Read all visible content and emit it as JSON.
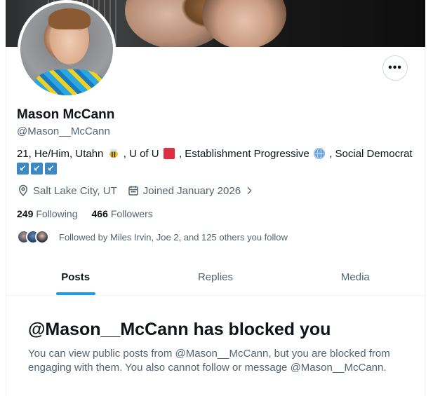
{
  "profile": {
    "name": "Mason McCann",
    "handle": "@Mason__McCann",
    "bio_part1": "21, He/Him, Utahn",
    "bio_part2": ", U of U",
    "bio_part3": ", Establishment Progressive",
    "bio_part4": ", Social Democrat",
    "location": "Salt Lake City, UT",
    "joined": "Joined January 2026",
    "following_count": "249",
    "following_label": "Following",
    "followers_count": "466",
    "followers_label": "Followers",
    "followed_by": "Followed by Miles Irvin, Joe 2, and 125 others you follow"
  },
  "more_button": "•••",
  "tabs": [
    {
      "label": "Posts",
      "active": true
    },
    {
      "label": "Replies",
      "active": false
    },
    {
      "label": "Media",
      "active": false
    }
  ],
  "blocked": {
    "title": "@Mason__McCann has blocked you",
    "message": "You can view public posts from @Mason__McCann, but you are blocked from engaging with them. You also cannot follow or message @Mason__McCann."
  },
  "icons": {
    "location": "map-pin-icon",
    "calendar": "calendar-icon",
    "chevron": "chevron-right-icon",
    "bee": "bee-emoji",
    "red_square": "red-square-emoji",
    "globe": "globe-emoji",
    "arrows": "arrow-down-left-emoji"
  },
  "colors": {
    "accent": "#1d9bf0",
    "secondary_text": "#536471",
    "primary_text": "#0f1419"
  }
}
